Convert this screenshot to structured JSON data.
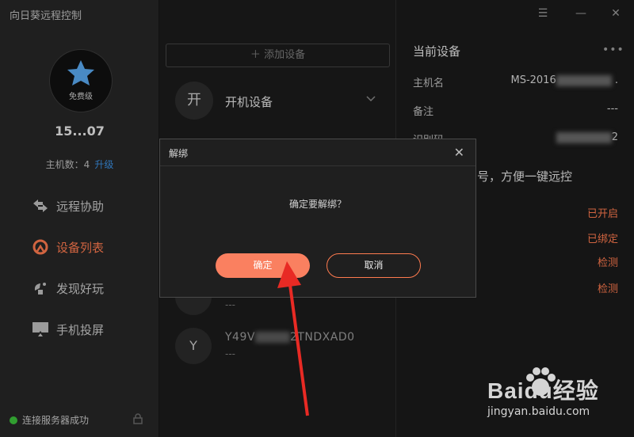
{
  "app": {
    "title": "向日葵远程控制"
  },
  "sidebar": {
    "tier": "免费级",
    "user_id": "15...07",
    "hosts_label": "主机数：4",
    "upgrade": "升级",
    "nav": [
      {
        "label": "远程协助",
        "icon": "remote-assist-icon",
        "active": false
      },
      {
        "label": "设备列表",
        "icon": "device-list-icon",
        "active": true
      },
      {
        "label": "发现好玩",
        "icon": "discover-icon",
        "active": false
      },
      {
        "label": "手机投屏",
        "icon": "screen-cast-icon",
        "active": false
      }
    ],
    "status": "连接服务器成功"
  },
  "middle": {
    "add_device": "添加设备",
    "group": {
      "avatar": "开",
      "title": "开机设备"
    },
    "devices": [
      {
        "avatar": "",
        "name": "",
        "note": "---"
      },
      {
        "avatar": "Y",
        "name_prefix": "Y49V",
        "name_suffix": "2TNDXAD0",
        "note": "---"
      }
    ]
  },
  "right": {
    "title": "当前设备",
    "rows": [
      {
        "label": "主机名",
        "value": "MS-2016"
      },
      {
        "label": "备注",
        "value": "---"
      },
      {
        "label": "识别码",
        "value": "2"
      }
    ],
    "tip": "号，方便一键远控",
    "statuses": [
      "已开启",
      "已绑定",
      "检测",
      "检测"
    ]
  },
  "dialog": {
    "title": "解绑",
    "message": "确定要解绑？",
    "ok": "确定",
    "cancel": "取消"
  },
  "watermark": {
    "logo": "Baidu经验",
    "url": "jingyan.baidu.com"
  },
  "colors": {
    "accent": "#ff7b4f",
    "ok_button": "#fa8060",
    "link": "#3b8fe0",
    "online": "#3cc13b"
  }
}
